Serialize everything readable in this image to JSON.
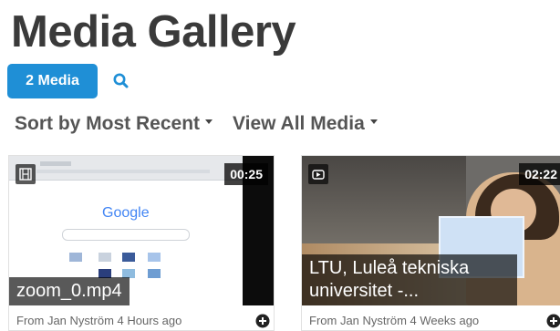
{
  "header": {
    "title": "Media Gallery"
  },
  "toolbar": {
    "count_label": "2 Media",
    "search_icon": "search-icon"
  },
  "sorting": {
    "sort_label": "Sort by Most Recent",
    "filter_label": "View All Media"
  },
  "colors": {
    "accent": "#1f8fd6",
    "title": "#3a3a3a",
    "muted": "#666666"
  },
  "media": [
    {
      "title": "zoom_0.mp4",
      "duration": "00:25",
      "meta": "From Jan Nyström 4 Hours ago",
      "type_icon": "film-icon",
      "thumbnail_text": "Google"
    },
    {
      "title": "LTU, Luleå tekniska universitet -...",
      "duration": "02:22",
      "meta": "From Jan Nyström 4 Weeks ago",
      "type_icon": "youtube-icon"
    }
  ]
}
